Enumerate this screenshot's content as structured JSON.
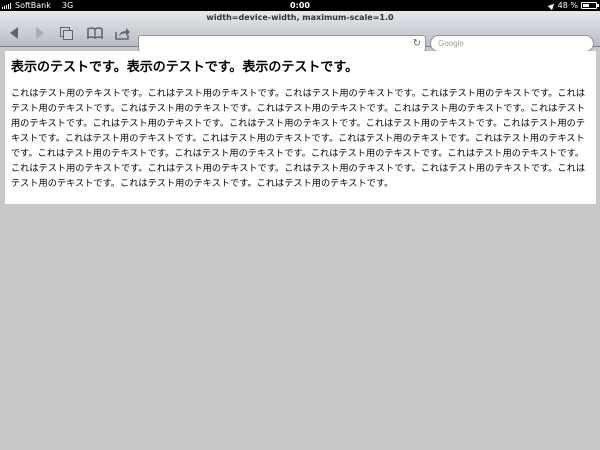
{
  "status_bar": {
    "carrier": "SoftBank",
    "network": "3G",
    "time": "0:00",
    "battery_percent": "48 %",
    "battery_level": 0.48
  },
  "toolbar": {
    "page_title": "width=device-width, maximum-scale=1.0",
    "address_value": "",
    "search_placeholder": "Google",
    "icons": [
      "back-icon",
      "forward-icon",
      "pages-icon",
      "bookmarks-icon",
      "share-icon",
      "reload-icon"
    ]
  },
  "page": {
    "heading": "表示のテストです。表示のテストです。表示のテストです。",
    "paragraph": "これはテスト用のテキストです。これはテスト用のテキストです。これはテスト用のテキストです。これはテスト用のテキストです。これはテスト用のテキストです。これはテスト用のテキストです。これはテスト用のテキストです。これはテスト用のテキストです。これはテスト用のテキストです。これはテスト用のテキストです。これはテスト用のテキストです。これはテスト用のテキストです。これはテスト用のテキストです。これはテスト用のテキストです。これはテスト用のテキストです。これはテスト用のテキストです。これはテスト用のテキストです。これはテスト用のテキストです。これはテスト用のテキストです。これはテスト用のテキストです。これはテスト用のテキストです。これはテスト用のテキストです。これはテスト用のテキストです。これはテスト用のテキストです。これはテスト用のテキストです。これはテスト用のテキストです。これはテスト用のテキストです。これはテスト用のテキストです。"
  },
  "colors": {
    "status_bar": "#000000",
    "toolbar_top": "#e6e8ec",
    "toolbar_bottom": "#b8bdc6",
    "page_background": "#c8c8c8",
    "content_background": "#ffffff"
  }
}
